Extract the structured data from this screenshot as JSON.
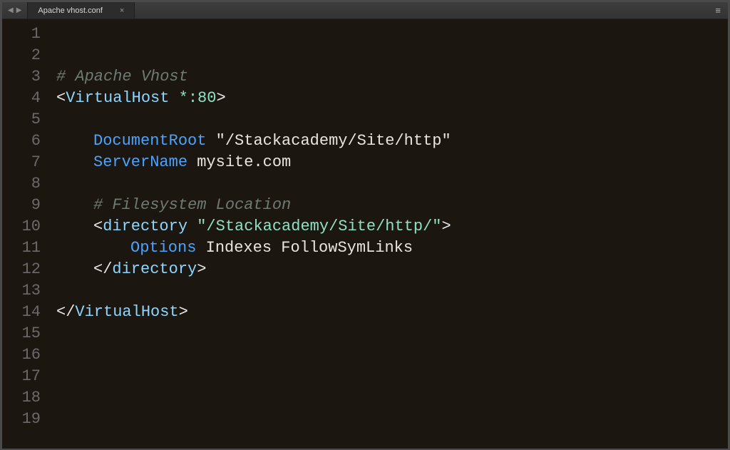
{
  "tab": {
    "title": "Apache vhost.conf",
    "close_glyph": "×"
  },
  "nav": {
    "back_glyph": "◀",
    "fwd_glyph": "▶",
    "menu_glyph": "≡"
  },
  "gutter": {
    "start": 1,
    "end": 19
  },
  "code": {
    "lines": [
      {
        "type": "blank"
      },
      {
        "type": "blank"
      },
      {
        "type": "comment",
        "text": "# Apache Vhost"
      },
      {
        "type": "tag_open",
        "tag": "VirtualHost",
        "arg": "*:80"
      },
      {
        "type": "blank"
      },
      {
        "type": "kv",
        "indent": 1,
        "key": "DocumentRoot",
        "val": "\"/Stackacademy/Site/http\""
      },
      {
        "type": "kv",
        "indent": 1,
        "key": "ServerName",
        "val": "mysite.com"
      },
      {
        "type": "blank"
      },
      {
        "type": "comment",
        "indent": 1,
        "text": "# Filesystem Location"
      },
      {
        "type": "tag_open",
        "indent": 1,
        "tag": "directory",
        "arg": "\"/Stackacademy/Site/http/\""
      },
      {
        "type": "kv",
        "indent": 2,
        "key": "Options",
        "val": "Indexes FollowSymLinks"
      },
      {
        "type": "tag_close",
        "indent": 1,
        "tag": "directory"
      },
      {
        "type": "blank"
      },
      {
        "type": "tag_close",
        "tag": "VirtualHost"
      },
      {
        "type": "blank"
      },
      {
        "type": "blank"
      },
      {
        "type": "blank"
      },
      {
        "type": "blank"
      },
      {
        "type": "blank"
      }
    ]
  }
}
